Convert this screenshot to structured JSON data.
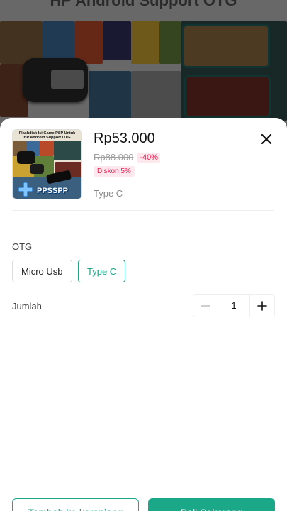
{
  "background": {
    "title": "HP Android Support OTG"
  },
  "product": {
    "thumbnail": {
      "caption_line1": "Flashdisk Isi Game PSP Untuk",
      "caption_line2": "HP Android Support OTG",
      "logo_text": "PPSSPP"
    },
    "price": "Rp53.000",
    "original_price": "Rp88.000",
    "discount_percent": "-40%",
    "discount_badge": "Diskon 5%",
    "selected_variant": "Type C"
  },
  "variant_group": {
    "label": "OTG",
    "options": [
      {
        "label": "Micro Usb",
        "selected": false
      },
      {
        "label": "Type C",
        "selected": true
      }
    ]
  },
  "quantity": {
    "label": "Jumlah",
    "value": "1"
  },
  "actions": {
    "add_to_cart": "Tambah ke keranjang",
    "buy_now": "Beli Sekarang"
  },
  "colors": {
    "accent": "#1aa889",
    "discount": "#e8204f"
  }
}
